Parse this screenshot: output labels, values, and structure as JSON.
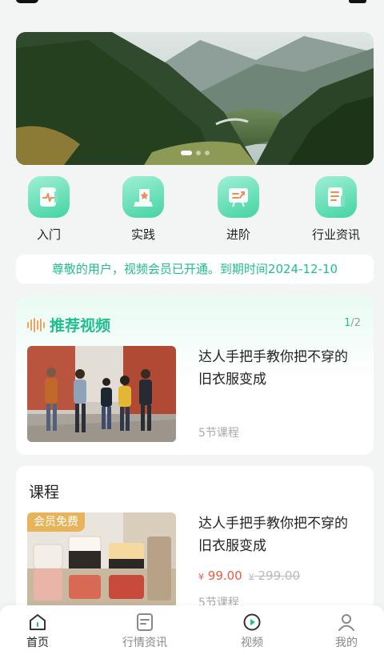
{
  "quick_entries": [
    {
      "label": "入门",
      "icon": "intro-icon"
    },
    {
      "label": "实践",
      "icon": "practice-icon"
    },
    {
      "label": "进阶",
      "icon": "advanced-icon"
    },
    {
      "label": "行业资讯",
      "icon": "industry-news-icon"
    }
  ],
  "notice": "尊敬的用户，视频会员已开通。到期时间2024-12-10",
  "recommend": {
    "title": "推荐视频",
    "pager_current": "1",
    "pager_total": "/2",
    "video": {
      "title": "达人手把手教你把不穿的旧衣服变成",
      "lessons": "5节课程"
    }
  },
  "course": {
    "heading": "课程",
    "badge": "会员免费",
    "title": "达人手把手教你把不穿的旧衣服变成",
    "price_symbol": "¥",
    "price": "99.00",
    "old_price_symbol": "¥",
    "old_price": "299.00",
    "lessons": "5节课程"
  },
  "tabbar": [
    {
      "label": "首页",
      "icon": "home-icon",
      "active": true
    },
    {
      "label": "行情资讯",
      "icon": "news-icon",
      "active": false
    },
    {
      "label": "视频",
      "icon": "video-icon",
      "active": false
    },
    {
      "label": "我的",
      "icon": "profile-icon",
      "active": false
    }
  ],
  "colors": {
    "accent": "#1fbf8f",
    "price": "#f05a3e",
    "badge": "#e7b35b"
  }
}
